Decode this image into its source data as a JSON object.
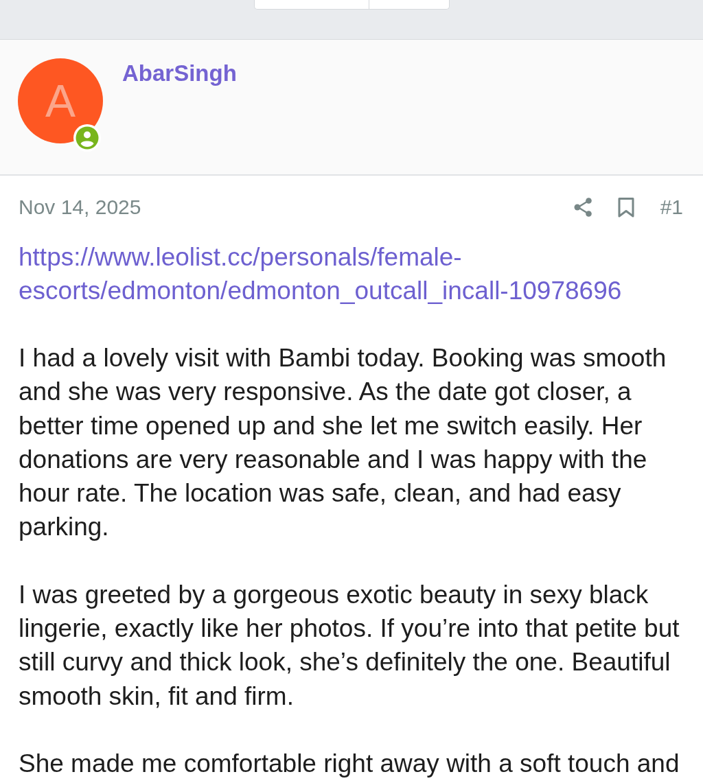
{
  "post": {
    "author": {
      "name": "AbarSingh",
      "avatar_letter": "A",
      "online": true
    },
    "date": "Nov 14, 2025",
    "post_number": "#1",
    "link": "https://www.leolist.cc/personals/female-escorts/edmonton/edmonton_outcall_incall-10978696",
    "paragraphs": [
      "I had a lovely visit with Bambi today. Booking was smooth and she was very responsive. As the date got closer, a better time opened up and she let me switch easily. Her donations are very reasonable and I was happy with the hour rate. The location was safe, clean, and had easy parking.",
      "I was greeted by a gorgeous exotic beauty in sexy black lingerie, exactly like her photos. If you’re into that petite but still curvy and thick look, she’s definitely the one. Beautiful smooth skin, fit and firm.",
      "She made me comfortable right away with a soft touch and"
    ]
  }
}
